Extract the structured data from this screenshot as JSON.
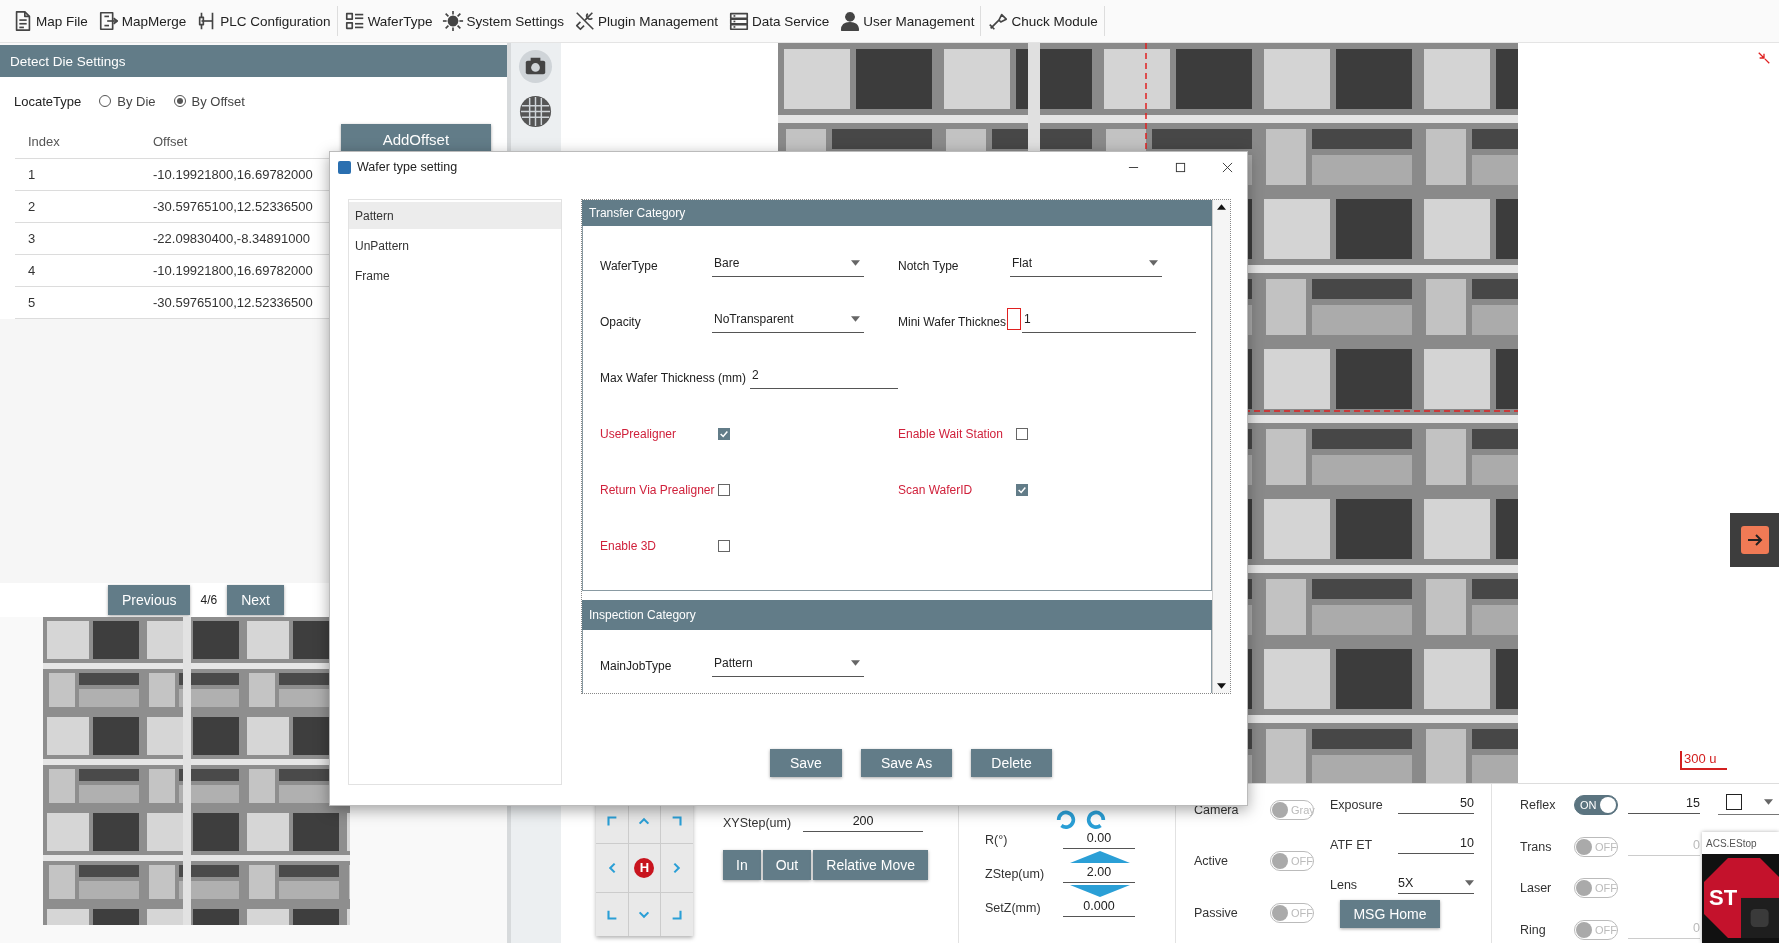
{
  "toolbar_groups": [
    {
      "items": [
        {
          "label": "Map File"
        },
        {
          "label": "MapMerge"
        },
        {
          "label": "PLC Configuration"
        }
      ]
    },
    {
      "items": [
        {
          "label": "WaferType"
        },
        {
          "label": "System Settings"
        },
        {
          "label": "Plugin Management"
        },
        {
          "label": "Data Service"
        },
        {
          "label": "User Management"
        }
      ]
    },
    {
      "items": [
        {
          "label": "Chuck Module"
        }
      ]
    }
  ],
  "detect_die_settings": {
    "title": "Detect Die Settings",
    "locate_type": {
      "label": "LocateType",
      "options": [
        {
          "label": "By Die",
          "selected": false
        },
        {
          "label": "By Offset",
          "selected": true
        }
      ]
    },
    "add_button": "AddOffset",
    "table": {
      "columns": [
        "Index",
        "Offset"
      ],
      "rows": [
        {
          "cells": [
            "1",
            "-10.19921800,16.69782000"
          ]
        },
        {
          "cells": [
            "2",
            "-30.59765100,12.52336500"
          ]
        },
        {
          "cells": [
            "3",
            "-22.09830400,-8.34891000"
          ]
        },
        {
          "cells": [
            "4",
            "-10.19921800,16.69782000"
          ]
        },
        {
          "cells": [
            "5",
            "-30.59765100,12.52336500"
          ]
        }
      ]
    },
    "pager": {
      "previous": "Previous",
      "page": "4/6",
      "next": "Next"
    }
  },
  "view": {
    "scale_label": "300 u"
  },
  "motion": {
    "pad_center": "H",
    "xy_step": {
      "label": "XYStep(um)",
      "value": "200"
    },
    "buttons": [
      "In",
      "Out",
      "Relative Move"
    ],
    "rotation": {
      "label": "R(°)",
      "value": "0.00"
    },
    "z_step": {
      "label": "ZStep(um)",
      "value": "2.00"
    },
    "set_z": {
      "label": "SetZ(mm)",
      "value": "0.000"
    }
  },
  "camera": {
    "modes": [
      {
        "label": "Camera",
        "on": false,
        "state_text": "Gray"
      },
      {
        "label": "Active",
        "on": false,
        "state_text": "OFF"
      },
      {
        "label": "Passive",
        "on": false,
        "state_text": "OFF"
      }
    ],
    "exposure": {
      "label": "Exposure",
      "value": "50"
    },
    "atf_et": {
      "label": "ATF ET",
      "value": "10"
    },
    "lens": {
      "label": "Lens",
      "value": "5X"
    },
    "msg_home": "MSG Home"
  },
  "lights": [
    {
      "label": "Reflex",
      "on": true,
      "state_text": "ON",
      "value": "15"
    },
    {
      "label": "Trans",
      "on": false,
      "state_text": "OFF",
      "value": "0"
    },
    {
      "label": "Laser",
      "on": false,
      "state_text": "OFF"
    },
    {
      "label": "Ring",
      "on": false,
      "state_text": "OFF",
      "value": "0"
    }
  ],
  "estop": {
    "title": "ACS.EStop",
    "sign_text": "ST"
  },
  "dialog": {
    "title": "Wafer type setting",
    "categories": [
      {
        "label": "Pattern",
        "selected": true
      },
      {
        "label": "UnPattern",
        "selected": false
      },
      {
        "label": "Frame",
        "selected": false
      }
    ],
    "sections": [
      {
        "title": "Transfer Category",
        "rows": [
          [
            {
              "kind": "dropdown",
              "label": "WaferType",
              "value": "Bare"
            },
            {
              "kind": "dropdown",
              "label": "Notch Type",
              "value": "Flat"
            }
          ],
          [
            {
              "kind": "dropdown",
              "label": "Opacity",
              "value": "NoTransparent"
            },
            {
              "kind": "input",
              "label": "Mini Wafer Thicknes",
              "value": "1",
              "highlighted": true
            }
          ],
          [
            {
              "kind": "input",
              "label": "Max Wafer Thickness (mm)",
              "value": "2"
            }
          ],
          [
            {
              "kind": "checkbox",
              "label": "UsePrealigner",
              "checked": true
            },
            {
              "kind": "checkbox",
              "label": "Enable Wait Station",
              "checked": false
            }
          ],
          [
            {
              "kind": "checkbox",
              "label": "Return Via Prealigner",
              "checked": false
            },
            {
              "kind": "checkbox",
              "label": "Scan WaferID",
              "checked": true
            }
          ],
          [
            {
              "kind": "checkbox",
              "label": "Enable 3D",
              "checked": false
            }
          ]
        ]
      },
      {
        "title": "Inspection Category",
        "rows": [
          [
            {
              "kind": "dropdown",
              "label": "MainJobType",
              "value": "Pattern"
            }
          ]
        ]
      }
    ],
    "buttons": [
      "Save",
      "Save As",
      "Delete"
    ]
  }
}
